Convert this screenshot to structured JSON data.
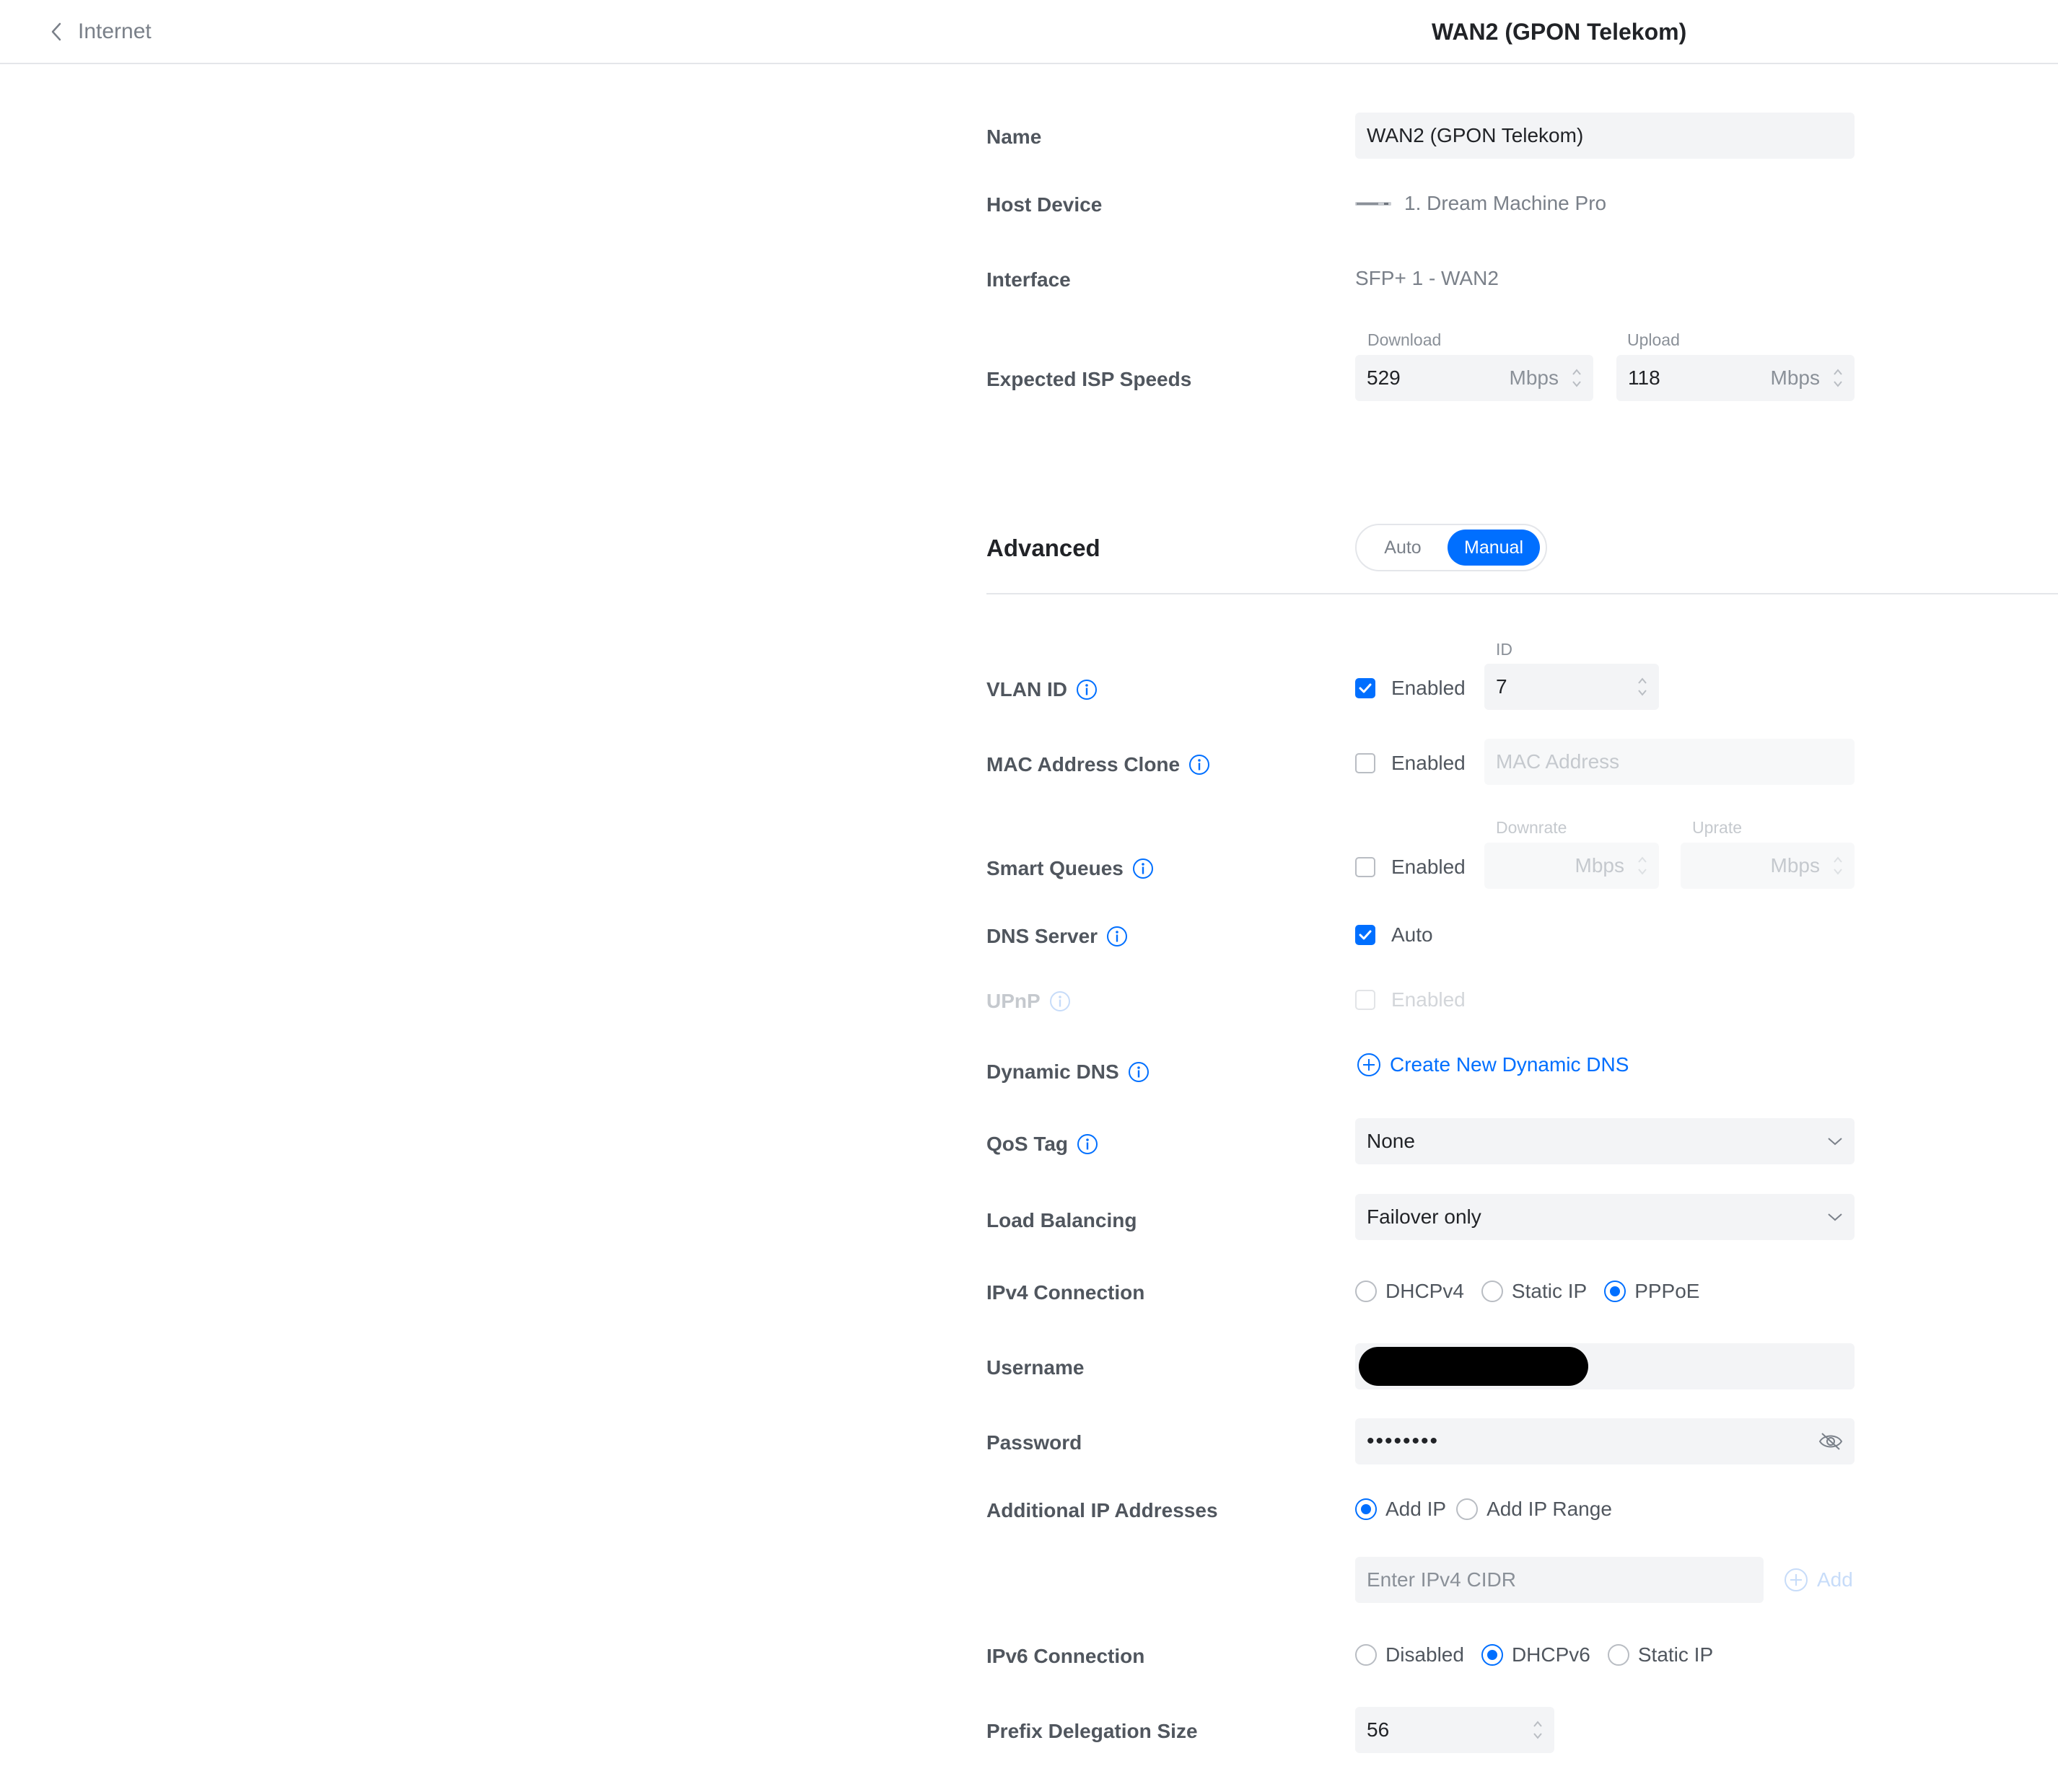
{
  "header": {
    "back_label": "Internet",
    "title": "WAN2 (GPON Telekom)"
  },
  "form": {
    "name": {
      "label": "Name",
      "value": "WAN2 (GPON Telekom)"
    },
    "host_device": {
      "label": "Host Device",
      "value": "1. Dream Machine Pro"
    },
    "interface": {
      "label": "Interface",
      "value": "SFP+ 1 - WAN2"
    },
    "isp_speeds": {
      "label": "Expected ISP Speeds",
      "download_label": "Download",
      "download_value": "529",
      "upload_label": "Upload",
      "upload_value": "118",
      "unit": "Mbps"
    }
  },
  "advanced": {
    "label": "Advanced",
    "toggle": {
      "auto": "Auto",
      "manual": "Manual",
      "selected": "Manual"
    },
    "vlan": {
      "label": "VLAN ID",
      "enabled_label": "Enabled",
      "enabled": true,
      "id_label": "ID",
      "id_value": "7"
    },
    "mac_clone": {
      "label": "MAC Address Clone",
      "enabled_label": "Enabled",
      "enabled": false,
      "placeholder": "MAC Address"
    },
    "smart_queues": {
      "label": "Smart Queues",
      "enabled_label": "Enabled",
      "enabled": false,
      "downrate_label": "Downrate",
      "uprate_label": "Uprate",
      "unit": "Mbps"
    },
    "dns": {
      "label": "DNS Server",
      "auto_label": "Auto",
      "auto": true
    },
    "upnp": {
      "label": "UPnP",
      "enabled_label": "Enabled",
      "enabled": false
    },
    "ddns": {
      "label": "Dynamic DNS",
      "create_label": "Create New Dynamic DNS"
    },
    "qos": {
      "label": "QoS Tag",
      "value": "None"
    },
    "load_balancing": {
      "label": "Load Balancing",
      "value": "Failover only"
    },
    "ipv4": {
      "label": "IPv4 Connection",
      "options": [
        "DHCPv4",
        "Static IP",
        "PPPoE"
      ],
      "selected": "PPPoE"
    },
    "username": {
      "label": "Username"
    },
    "password": {
      "label": "Password",
      "value": "••••••••"
    },
    "additional_ips": {
      "label": "Additional IP Addresses",
      "options": [
        "Add IP",
        "Add IP Range"
      ],
      "selected": "Add IP",
      "placeholder": "Enter IPv4 CIDR",
      "add_label": "Add"
    },
    "ipv6": {
      "label": "IPv6 Connection",
      "options": [
        "Disabled",
        "DHCPv6",
        "Static IP"
      ],
      "selected": "DHCPv6"
    },
    "prefix": {
      "label": "Prefix Delegation Size",
      "value": "56"
    }
  },
  "colors": {
    "accent": "#006fff",
    "label": "#50565e",
    "field_bg": "#f3f4f6"
  }
}
